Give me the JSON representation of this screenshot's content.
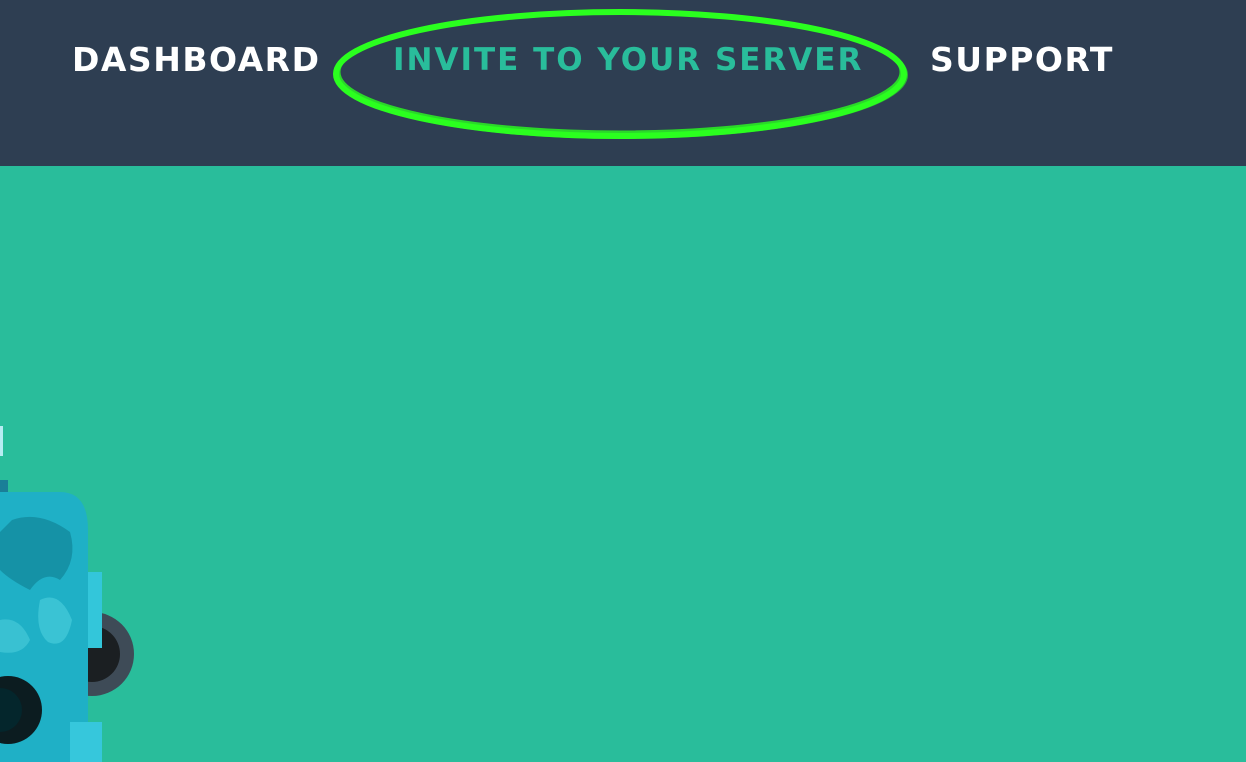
{
  "nav": {
    "dashboard_label": "DASHBOARD",
    "invite_label": "INVITE TO YOUR SERVER",
    "support_label": "SUPPORT"
  },
  "colors": {
    "navbar_bg": "#2e3e52",
    "page_bg": "#29bd9b",
    "accent_text": "#29bd9b",
    "highlight_stroke": "#2bff1f",
    "nav_text": "#ffffff"
  },
  "icons": {
    "mascot": "robot-mascot-icon"
  }
}
